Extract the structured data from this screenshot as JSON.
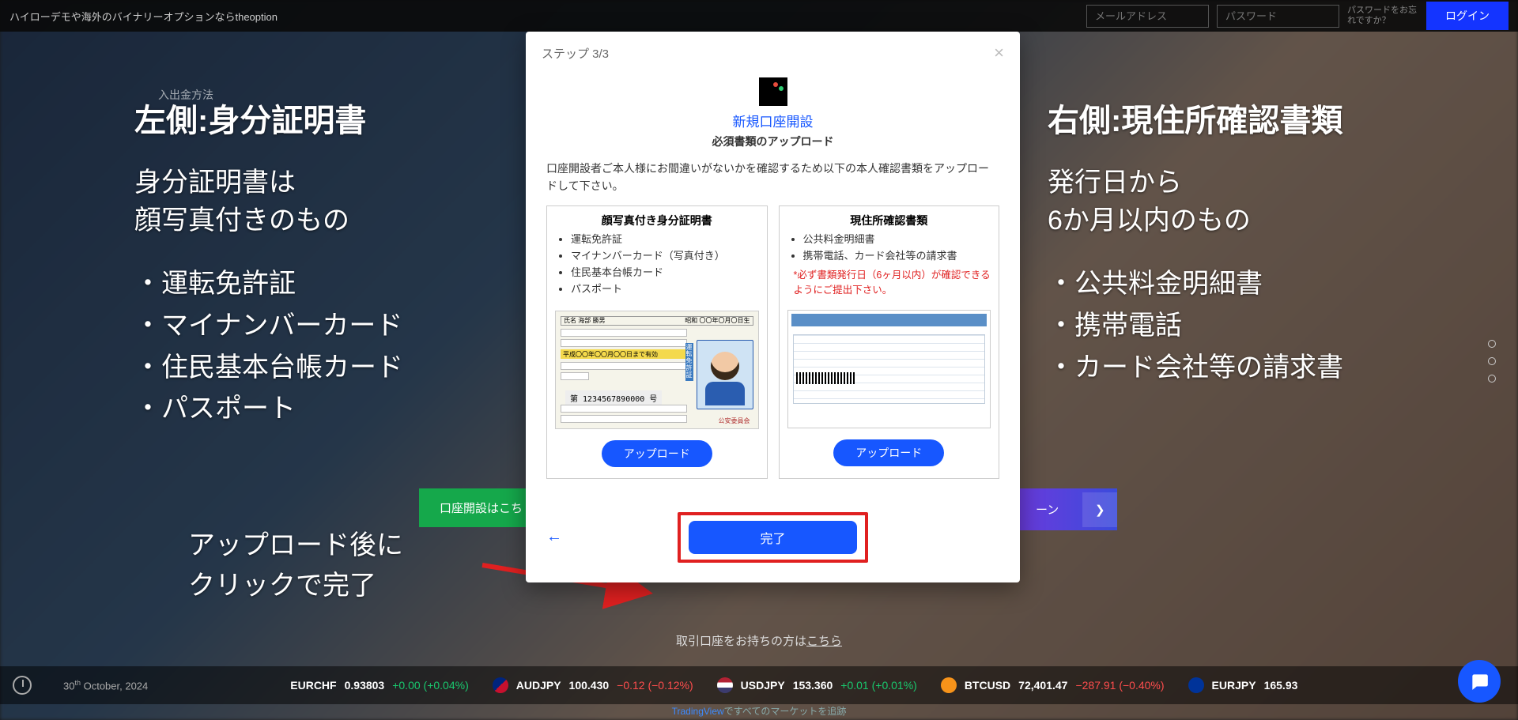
{
  "topbar": {
    "tagline": "ハイローデモや海外のバイナリーオプションならtheoption",
    "email_placeholder": "メールアドレス",
    "password_placeholder": "パスワード",
    "forgot": "パスワードをお忘れですか？",
    "login": "ログイン"
  },
  "nav": {
    "item1": "入出金方法"
  },
  "overlay_left": {
    "heading": "左側:身分証明書",
    "sub": "身分証明書は\n顔写真付きのもの",
    "items": [
      "運転免許証",
      "マイナンバーカード",
      "住民基本台帳カード",
      "パスポート"
    ]
  },
  "overlay_right": {
    "heading": "右側:現住所確認書類",
    "sub": "発行日から\n6か月以内のもの",
    "items": [
      "公共料金明細書",
      "携帯電話",
      "カード会社等の請求書"
    ]
  },
  "overlay_bottom": {
    "l1": "アップロード後に",
    "l2": "クリックで完了"
  },
  "modal": {
    "step": "ステップ 3/3",
    "title_link": "新規口座開設",
    "subtitle": "必須書類のアップロード",
    "desc": "口座開設者ご本人様にお間違いがないかを確認するため以下の本人確認書類をアップロードして下さい。",
    "card_left": {
      "title": "顔写真付き身分証明書",
      "items": [
        "運転免許証",
        "マイナンバーカード（写真付き）",
        "住民基本台帳カード",
        "パスポート"
      ],
      "id_name_label": "氏名 海部 勝男",
      "id_bar_right": "昭和 〇〇年〇月〇日生",
      "id_yellow": "平成〇〇年〇〇月〇〇日まで有効",
      "id_number_label": "第",
      "id_number": "第 1234567890000 号",
      "id_commission": "公安委員会",
      "id_side": "運転免許証",
      "upload": "アップロード"
    },
    "card_right": {
      "title": "現住所確認書類",
      "items": [
        "公共料金明細書",
        "携帯電話、カード会社等の請求書"
      ],
      "note": "*必ず書類発行日（6ヶ月以内）が確認できるようにご提出下さい。",
      "upload": "アップロード"
    },
    "finish": "完了"
  },
  "under_modal": {
    "text": "取引口座をお持ちの方は",
    "link": "こちら"
  },
  "hero": {
    "green": "口座開設はこち",
    "purple": "ーン"
  },
  "ticker": {
    "date_day": "30",
    "date_suffix": "th",
    "date_rest": " October, 2024",
    "items": [
      {
        "flag": "",
        "sym": "EURCHF",
        "price": "0.93803",
        "chg": "+0.00 (+0.04%)",
        "dir": "pos"
      },
      {
        "flag": "au",
        "sym": "AUDJPY",
        "price": "100.430",
        "chg": "−0.12 (−0.12%)",
        "dir": "neg"
      },
      {
        "flag": "us",
        "sym": "USDJPY",
        "price": "153.360",
        "chg": "+0.01 (+0.01%)",
        "dir": "pos"
      },
      {
        "flag": "btc",
        "sym": "BTCUSD",
        "price": "72,401.47",
        "chg": "−287.91 (−0.40%)",
        "dir": "neg"
      },
      {
        "flag": "eu",
        "sym": "EURJPY",
        "price": "165.93",
        "chg": "",
        "dir": ""
      }
    ]
  },
  "tradingview": {
    "brand": "TradingView",
    "rest": "ですべてのマーケットを追跡"
  }
}
